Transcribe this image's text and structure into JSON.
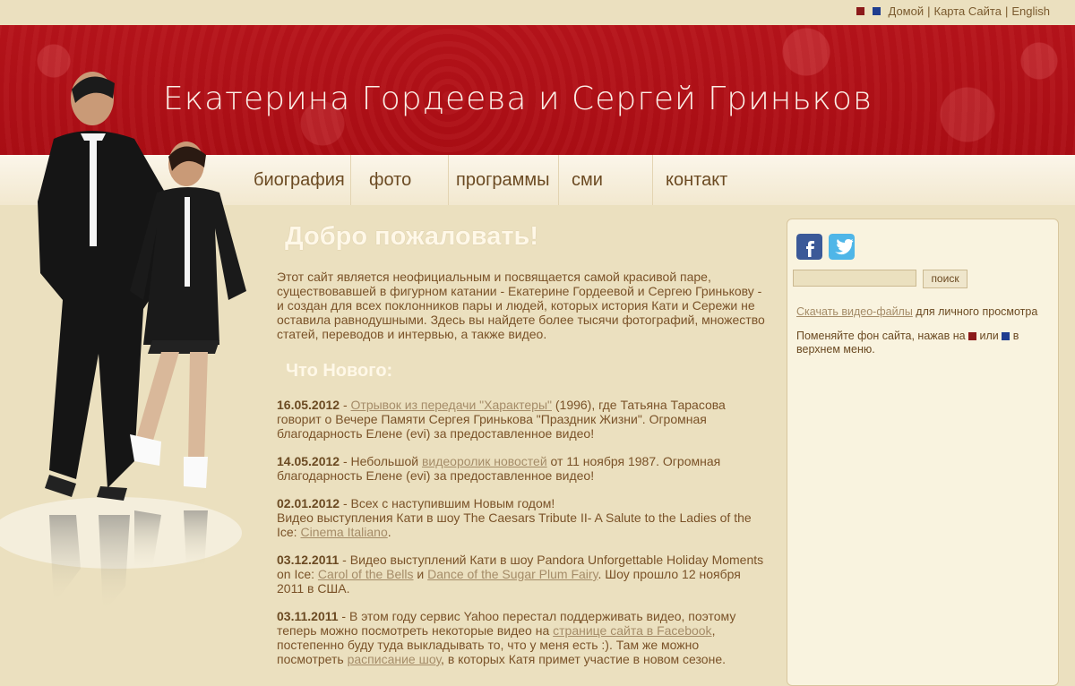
{
  "top_links": {
    "home": "Домой",
    "sitemap": "Карта Сайта",
    "english": "English",
    "sep": "|",
    "theme_red": "#8c1a1a",
    "theme_blue": "#1f3d8f"
  },
  "header": {
    "title": "Екатерина Гордеева и Сергей Гриньков"
  },
  "nav": [
    "биография",
    "фото",
    "программы",
    "сми",
    "контакт"
  ],
  "main": {
    "heading": "Добро пожаловать!",
    "intro": "Этот сайт является неофициальным и посвящается самой красивой паре, существовавшей в фигурном катании - Екатерине Гордеевой и Сергею Гринькову - и создан для всех поклонников пары и людей, которых история Кати и Сережи не оставила равнодушными. Здесь вы найдете более тысячи фотографий, множество статей, переводов и интервью, а также видео.",
    "news_heading": "Что Нового:",
    "news": [
      {
        "date": "16.05.2012",
        "t1": " - ",
        "l1": "Отрывок из передачи \"Характеры\"",
        "t2": " (1996), где Татьяна Тарасова говорит о Вечере Памяти Сергея Гринькова \"Праздник Жизни\". Огромная благодарность Елене (evi) за предоставленное видео!"
      },
      {
        "date": "14.05.2012",
        "t1": " - Небольшой ",
        "l1": "видеоролик новостей",
        "t2": " от 11 ноября 1987. Огромная благодарность Елене (evi) за предоставленное видео!"
      },
      {
        "date": "02.01.2012",
        "t1": " - Всех с наступившим Новым годом!",
        "line2": "Видео выступления Кати в шоу The Caesars Tribute II- A Salute to the Ladies of the Ice: ",
        "l1": "Cinema Italiano",
        "t2": "."
      },
      {
        "date": "03.12.2011",
        "t1": " - Видео выступлений Кати в шоу Pandora Unforgettable Holiday Moments on Ice: ",
        "l1": "Carol of the Bells",
        "t2": " и ",
        "l2": "Dance of the Sugar Plum Fairy",
        "t3": ". Шоу прошло 12 ноября 2011 в США."
      },
      {
        "date": "03.11.2011",
        "t1": " - В этом году сервис Yahoo перестал поддерживать видео, поэтому теперь можно посмотреть некоторые видео на ",
        "l1": "странице сайта в Facebook",
        "t2": ", постепенно буду туда выкладывать то, что у меня есть :). Там же можно посмотреть ",
        "l2": "расписание шоу",
        "t3": ", в которых Катя примет участие в новом сезоне."
      }
    ]
  },
  "sidebar": {
    "facebook_icon": "facebook-icon",
    "twitter_icon": "twitter-icon",
    "search_button": "поиск",
    "download_link": "Скачать видео-файлы",
    "download_rest": " для личного просмотра",
    "bg_text1": "Поменяйте фон сайта, нажав на ",
    "bg_or": " или ",
    "bg_text2": " в верхнем меню."
  }
}
